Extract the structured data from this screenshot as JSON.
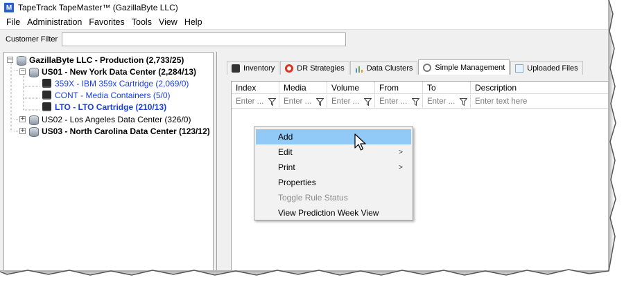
{
  "window": {
    "title": "TapeTrack TapeMaster™ (GazillaByte LLC)",
    "app_icon": "M"
  },
  "menu": [
    "File",
    "Administration",
    "Favorites",
    "Tools",
    "View",
    "Help"
  ],
  "customer_filter": {
    "label": "Customer Filter",
    "value": ""
  },
  "tree": {
    "root": "GazillaByte LLC - Production (2,733/25)",
    "us01": "US01 - New York Data Center (2,284/13)",
    "item_359x": "359X - IBM 359x Cartridge (2,069/0)",
    "item_cont": "CONT - Media Containers (5/0)",
    "item_lto": "LTO - LTO Cartridge (210/13)",
    "us02": "US02 - Los Angeles Data Center (326/0)",
    "us03": "US03 - North Carolina Data Center (123/12)"
  },
  "tabs": [
    "Inventory",
    "DR Strategies",
    "Data Clusters",
    "Simple Management",
    "Uploaded Files"
  ],
  "grid": {
    "columns": [
      "Index",
      "Media",
      "Volume",
      "From",
      "To",
      "Description"
    ],
    "filter_placeholder_short": "Enter ...",
    "filter_placeholder_full": "Enter text here"
  },
  "context_menu": {
    "add": "Add",
    "edit": "Edit",
    "print": "Print",
    "properties": "Properties",
    "toggle": "Toggle Rule Status",
    "prediction": "View Prediction Week View"
  }
}
